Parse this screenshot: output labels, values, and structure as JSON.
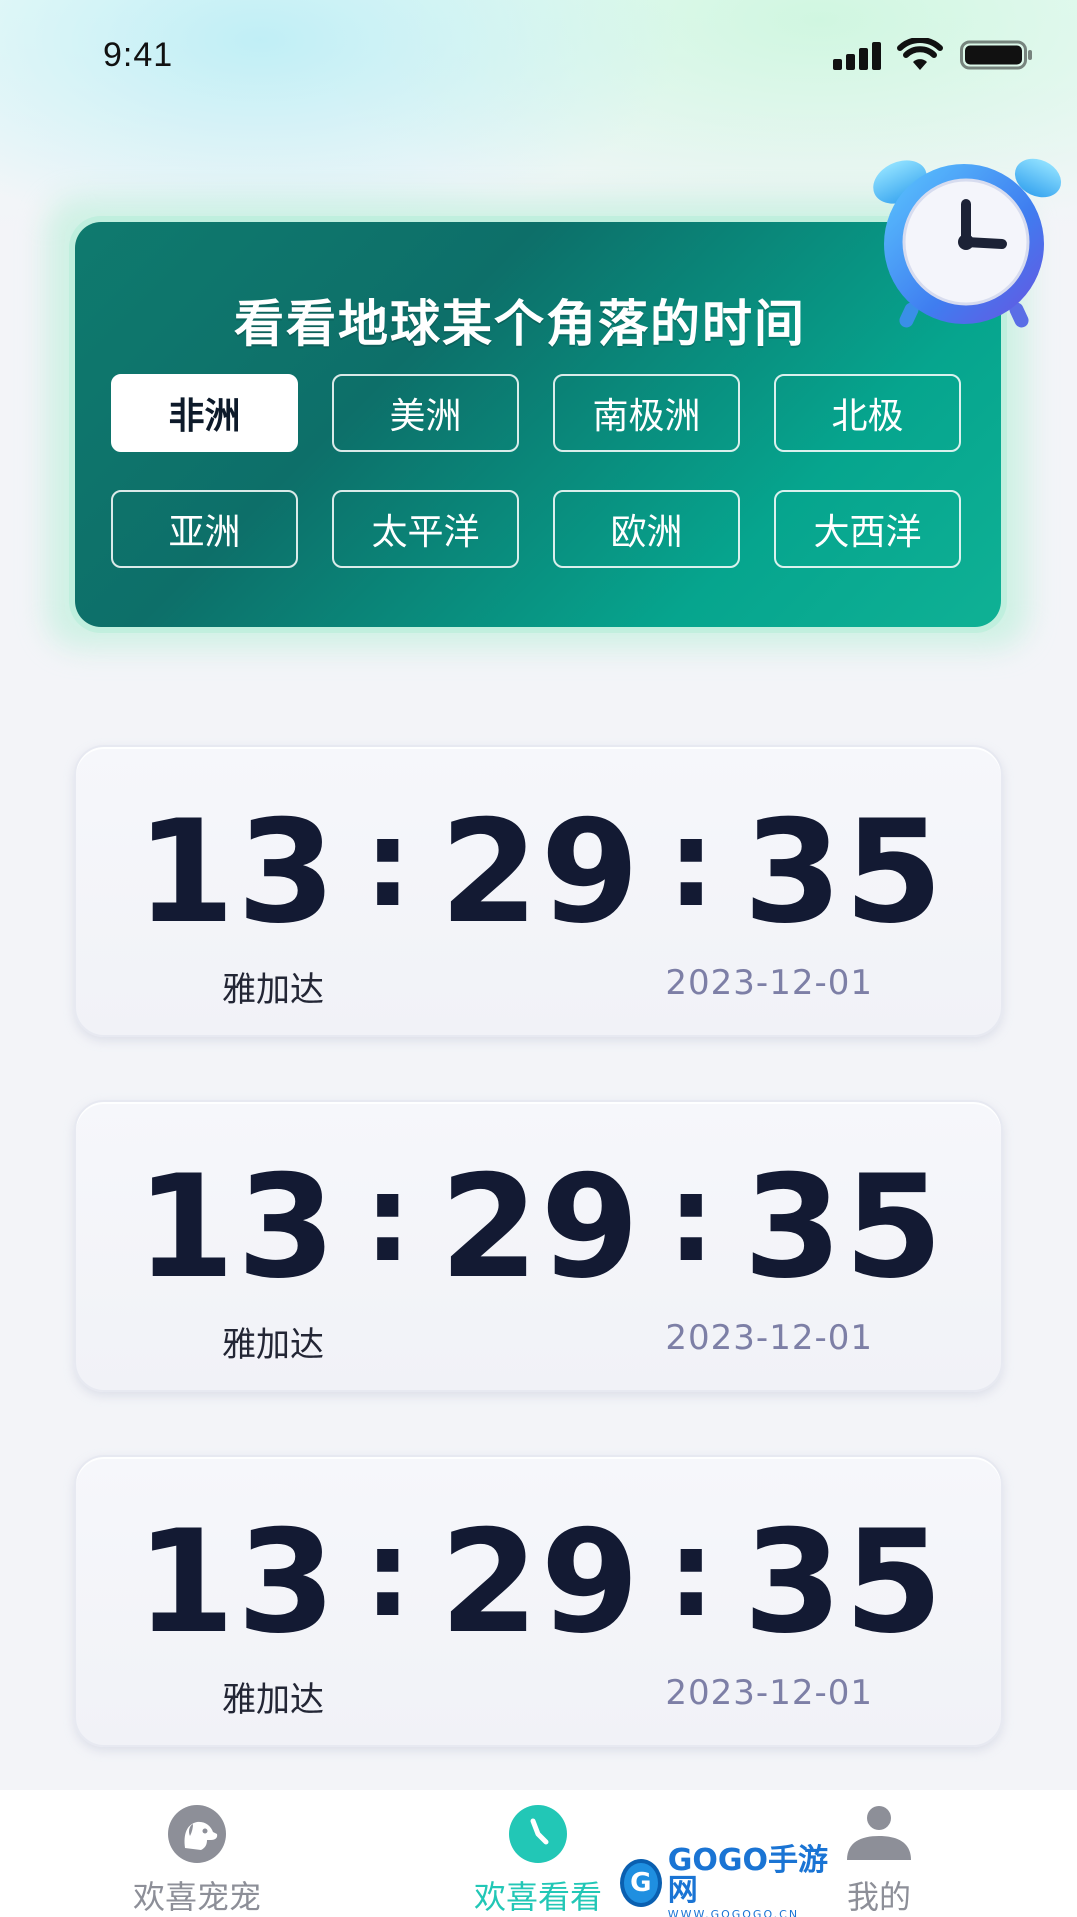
{
  "status_bar": {
    "time": "9:41"
  },
  "header": {
    "title": "看看地球某个角落的时间",
    "regions": [
      {
        "label": "非洲",
        "active": true
      },
      {
        "label": "美洲",
        "active": false
      },
      {
        "label": "南极洲",
        "active": false
      },
      {
        "label": "北极",
        "active": false
      },
      {
        "label": "亚洲",
        "active": false
      },
      {
        "label": "太平洋",
        "active": false
      },
      {
        "label": "欧洲",
        "active": false
      },
      {
        "label": "大西洋",
        "active": false
      }
    ]
  },
  "clocks": [
    {
      "hh": "13",
      "mm": "29",
      "ss": "35",
      "sep": ":",
      "city": "雅加达",
      "date": "2023-12-01"
    },
    {
      "hh": "13",
      "mm": "29",
      "ss": "35",
      "sep": ":",
      "city": "雅加达",
      "date": "2023-12-01"
    },
    {
      "hh": "13",
      "mm": "29",
      "ss": "35",
      "sep": ":",
      "city": "雅加达",
      "date": "2023-12-01"
    }
  ],
  "tab_bar": {
    "items": [
      {
        "label": "欢喜宠宠",
        "icon": "dog-icon",
        "active": false
      },
      {
        "label": "欢喜看看",
        "icon": "clock-icon",
        "active": true
      },
      {
        "label": "我的",
        "icon": "user-icon",
        "active": false
      }
    ]
  },
  "watermark": {
    "logo": "G",
    "main": "GOGO手游网",
    "sub": "WWW.GOGOGO.CN"
  },
  "colors": {
    "accent": "#22c7b6",
    "hero_dark": "#0d6f69",
    "hero_light": "#0fb195",
    "digits": "#131a33",
    "date": "#7d7fa6"
  }
}
